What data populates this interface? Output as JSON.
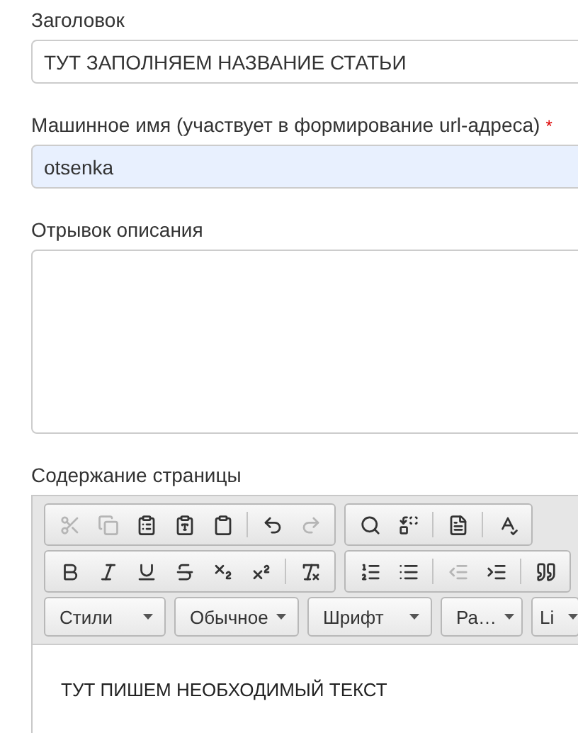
{
  "fields": [
    {
      "kind": "input",
      "label": "Заголовок",
      "value": "ТУТ ЗАПОЛНЯЕМ НАЗВАНИЕ СТАТЬИ",
      "highlighted": false
    },
    {
      "kind": "input",
      "label": "Машинное имя (участвует в формирование url-адреса)",
      "required_mark": "*",
      "value": "otsenka",
      "highlighted": true
    },
    {
      "kind": "textarea",
      "label": "Отрывок описания"
    }
  ],
  "editor": {
    "label": "Содержание страницы",
    "toolbar_rows": [
      [
        [
          {
            "kind": "cut",
            "disabled": true
          },
          {
            "kind": "copy",
            "disabled": true
          },
          {
            "kind": "paste",
            "disabled": false
          },
          {
            "kind": "paste-text",
            "disabled": false
          },
          {
            "kind": "paste-word",
            "disabled": false
          },
          {
            "kind": "sep"
          },
          {
            "kind": "undo",
            "disabled": false
          },
          {
            "kind": "redo",
            "disabled": true
          }
        ],
        [
          {
            "kind": "find",
            "disabled": false
          },
          {
            "kind": "replace",
            "disabled": false
          },
          {
            "kind": "sep"
          },
          {
            "kind": "select-all",
            "disabled": false
          },
          {
            "kind": "sep"
          },
          {
            "kind": "spellcheck",
            "disabled": false
          }
        ]
      ],
      [
        [
          {
            "kind": "bold",
            "disabled": false
          },
          {
            "kind": "italic",
            "disabled": false
          },
          {
            "kind": "underline",
            "disabled": false
          },
          {
            "kind": "strike",
            "disabled": false
          },
          {
            "kind": "subscript",
            "disabled": false
          },
          {
            "kind": "superscript",
            "disabled": false
          },
          {
            "kind": "sep"
          },
          {
            "kind": "remove-format",
            "disabled": false
          }
        ],
        [
          {
            "kind": "ordered-list",
            "disabled": false
          },
          {
            "kind": "bullet-list",
            "disabled": false
          },
          {
            "kind": "sep"
          },
          {
            "kind": "outdent",
            "disabled": true
          },
          {
            "kind": "indent",
            "disabled": false
          },
          {
            "kind": "sep"
          },
          {
            "kind": "blockquote",
            "disabled": false
          }
        ]
      ]
    ],
    "combos": [
      {
        "label": "Стили"
      },
      {
        "label": "Обычное"
      },
      {
        "label": "Шрифт"
      },
      {
        "label": "Ра…"
      },
      {
        "label": "Li"
      }
    ],
    "content": "ТУТ ПИШЕМ НЕОБХОДИМЫЙ ТЕКСТ"
  }
}
